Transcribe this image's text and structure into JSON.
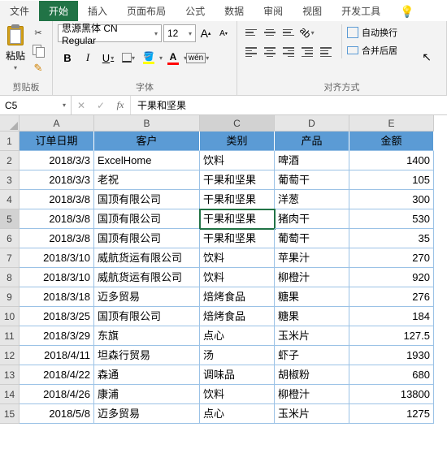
{
  "tabs": {
    "file": "文件",
    "home": "开始",
    "insert": "插入",
    "layout": "页面布局",
    "formulas": "公式",
    "data": "数据",
    "review": "审阅",
    "view": "视图",
    "dev": "开发工具"
  },
  "ribbon": {
    "paste": "粘贴",
    "clipboard": "剪贴板",
    "font_name": "思源黑体 CN Regular",
    "font_size": "12",
    "font_group": "字体",
    "align_group": "对齐方式",
    "wrap": "自动换行",
    "merge": "合并后居"
  },
  "namebox": "C5",
  "formula": "干果和坚果",
  "columns": [
    "A",
    "B",
    "C",
    "D",
    "E"
  ],
  "headers": [
    "订单日期",
    "客户",
    "类别",
    "产品",
    "金额"
  ],
  "rows": [
    {
      "date": "2018/3/3",
      "cust": "ExcelHome",
      "cat": "饮料",
      "prod": "啤酒",
      "amt": "1400"
    },
    {
      "date": "2018/3/3",
      "cust": "老祝",
      "cat": "干果和坚果",
      "prod": "葡萄干",
      "amt": "105"
    },
    {
      "date": "2018/3/8",
      "cust": "国顶有限公司",
      "cat": "干果和坚果",
      "prod": "洋葱",
      "amt": "300"
    },
    {
      "date": "2018/3/8",
      "cust": "国顶有限公司",
      "cat": "干果和坚果",
      "prod": "猪肉干",
      "amt": "530"
    },
    {
      "date": "2018/3/8",
      "cust": "国顶有限公司",
      "cat": "干果和坚果",
      "prod": "葡萄干",
      "amt": "35"
    },
    {
      "date": "2018/3/10",
      "cust": "威航货运有限公司",
      "cat": "饮料",
      "prod": "苹果汁",
      "amt": "270"
    },
    {
      "date": "2018/3/10",
      "cust": "威航货运有限公司",
      "cat": "饮料",
      "prod": "柳橙汁",
      "amt": "920"
    },
    {
      "date": "2018/3/18",
      "cust": "迈多贸易",
      "cat": "焙烤食品",
      "prod": "糖果",
      "amt": "276"
    },
    {
      "date": "2018/3/25",
      "cust": "国顶有限公司",
      "cat": "焙烤食品",
      "prod": "糖果",
      "amt": "184"
    },
    {
      "date": "2018/3/29",
      "cust": "东旗",
      "cat": "点心",
      "prod": "玉米片",
      "amt": "127.5"
    },
    {
      "date": "2018/4/11",
      "cust": "坦森行贸易",
      "cat": "汤",
      "prod": "虾子",
      "amt": "1930"
    },
    {
      "date": "2018/4/22",
      "cust": "森通",
      "cat": "调味品",
      "prod": "胡椒粉",
      "amt": "680"
    },
    {
      "date": "2018/4/26",
      "cust": "康浦",
      "cat": "饮料",
      "prod": "柳橙汁",
      "amt": "13800"
    },
    {
      "date": "2018/5/8",
      "cust": "迈多贸易",
      "cat": "点心",
      "prod": "玉米片",
      "amt": "1275"
    }
  ],
  "selected": {
    "row": 5,
    "col": "C"
  },
  "chart_data": null
}
